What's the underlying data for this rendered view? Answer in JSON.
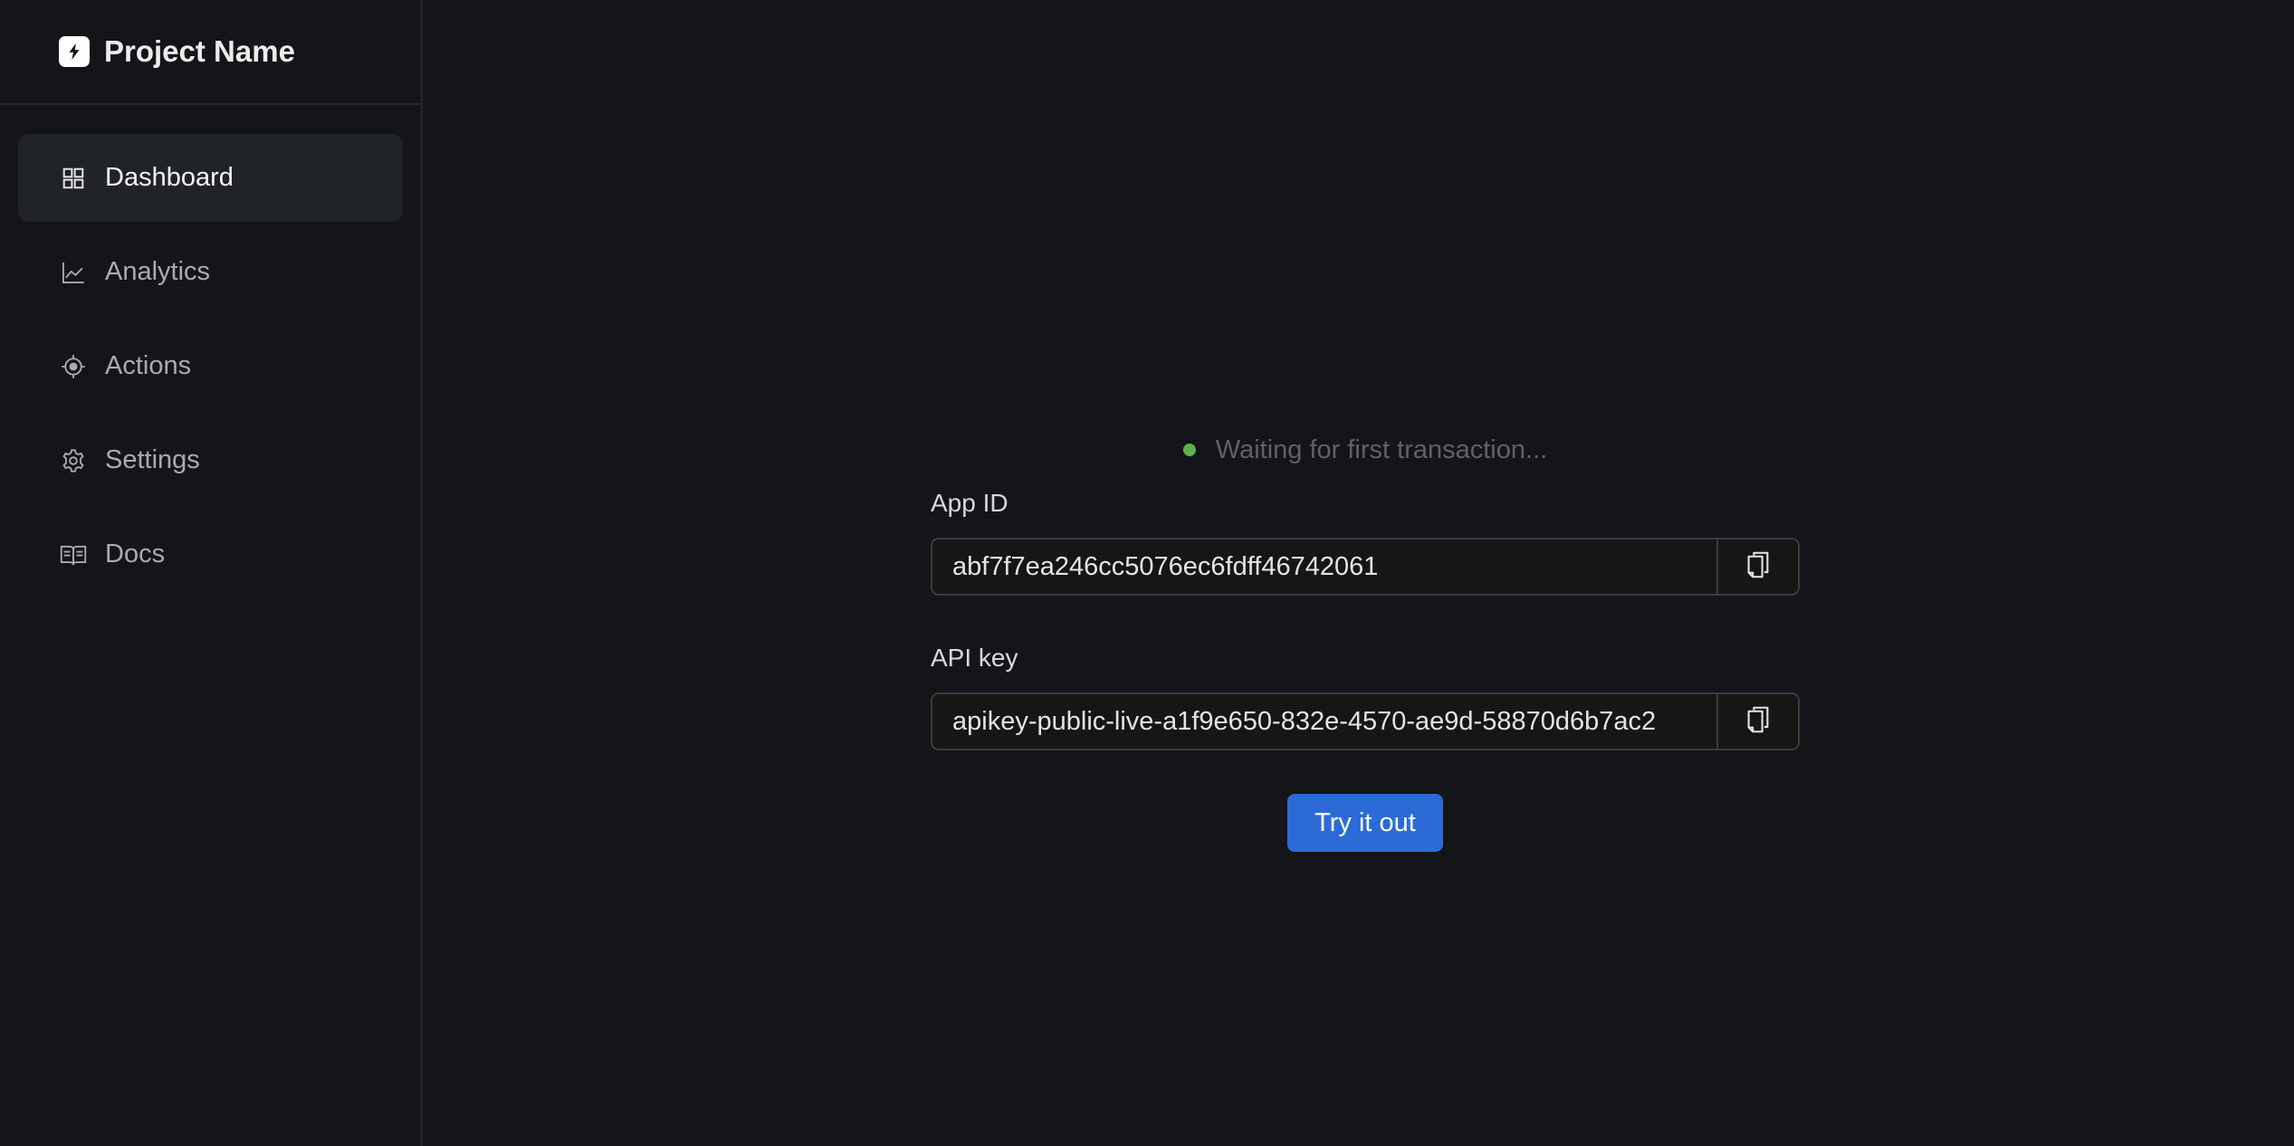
{
  "brand": {
    "name": "Project Name",
    "icon": "bolt-logo-icon"
  },
  "sidebar": {
    "items": [
      {
        "label": "Dashboard",
        "icon": "grid-icon",
        "active": true
      },
      {
        "label": "Analytics",
        "icon": "line-chart-icon",
        "active": false
      },
      {
        "label": "Actions",
        "icon": "crosshair-icon",
        "active": false
      },
      {
        "label": "Settings",
        "icon": "gear-icon",
        "active": false
      },
      {
        "label": "Docs",
        "icon": "book-icon",
        "active": false
      }
    ]
  },
  "main": {
    "status": {
      "text": "Waiting for first transaction...",
      "dot_color": "#5fb04a"
    },
    "app_id": {
      "label": "App ID",
      "value": "abf7f7ea246cc5076ec6fdff46742061",
      "copy_icon": "copy-icon"
    },
    "api_key": {
      "label": "API key",
      "value": "apikey-public-live-a1f9e650-832e-4570-ae9d-58870d6b7ac2",
      "copy_icon": "copy-icon"
    },
    "try_button": {
      "label": "Try it out",
      "color": "#2c6bd6"
    }
  }
}
